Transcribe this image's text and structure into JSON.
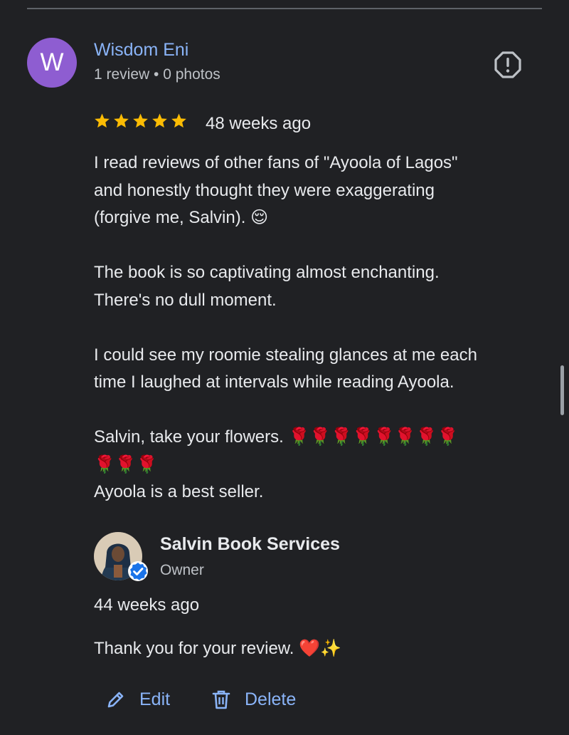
{
  "reviewer": {
    "initial": "W",
    "name": "Wisdom Eni",
    "meta": "1 review • 0 photos",
    "avatar_color": "#8e5dd1"
  },
  "review": {
    "rating": 5,
    "star_color": "#fbbc04",
    "age": "48 weeks ago",
    "text": "I read reviews of other fans of \"Ayoola of Lagos\"\nand honestly thought they were exaggerating\n(forgive me, Salvin). 😌\n\nThe book is so captivating almost enchanting.\nThere's no dull moment.\n\nI could see my roomie stealing glances at me each\ntime I laughed at intervals while reading Ayoola.\n\nSalvin, take your flowers. 🌹🌹🌹🌹🌹🌹🌹🌹\n🌹🌹🌹\nAyoola is a best seller."
  },
  "owner_reply": {
    "name": "Salvin Book Services",
    "role": "Owner",
    "age": "44 weeks ago",
    "text": "Thank you for your review. ❤️✨"
  },
  "actions": {
    "edit_label": "Edit",
    "delete_label": "Delete"
  },
  "icons": {
    "report": "report-icon",
    "star": "star-icon",
    "verified": "verified-badge-icon",
    "edit": "pencil-icon",
    "delete": "trash-icon"
  },
  "colors": {
    "background": "#202124",
    "link": "#8ab4f8",
    "verified": "#1a73e8"
  }
}
